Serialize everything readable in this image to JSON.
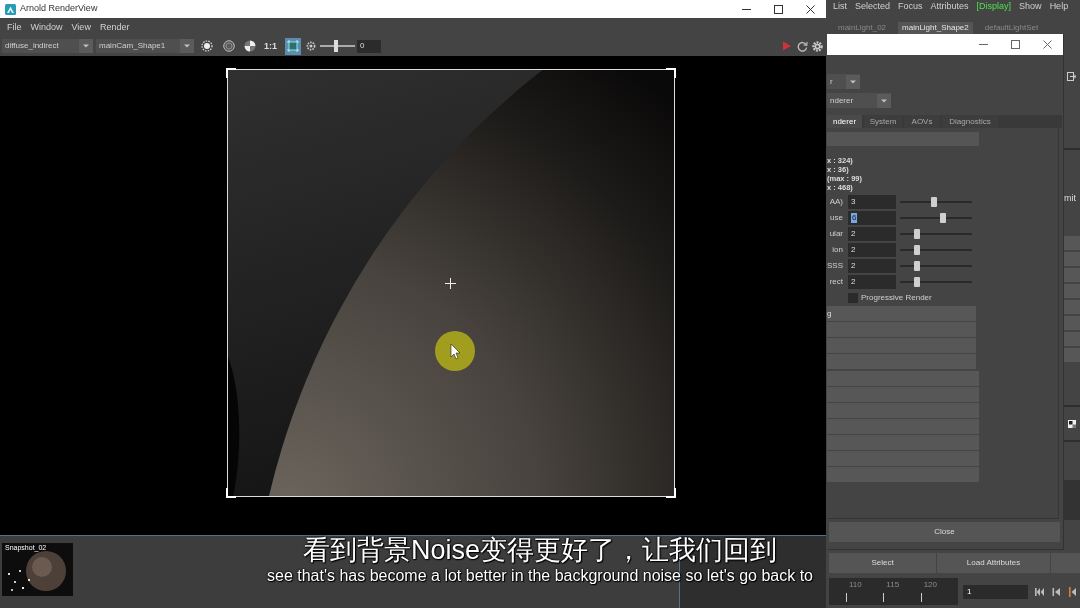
{
  "render_view": {
    "title": "Arnold RenderView",
    "menu": [
      "File",
      "Window",
      "View",
      "Render"
    ],
    "toolbar": {
      "aov": "diffuse_indirect",
      "camera": "mainCam_Shape1",
      "zoom": "1:1",
      "crop_region": true,
      "exposure": {
        "level": 0.45,
        "value": "0"
      }
    },
    "snapshots": [
      {
        "label": "Snapshot_02"
      }
    ]
  },
  "attribute_editor": {
    "menu": [
      {
        "label": "List",
        "active": false
      },
      {
        "label": "Selected",
        "active": false
      },
      {
        "label": "Focus",
        "active": false
      },
      {
        "label": "Attributes",
        "active": false
      },
      {
        "label": "[Display]",
        "active": true
      },
      {
        "label": "Show",
        "active": false
      },
      {
        "label": "Help",
        "active": false
      }
    ],
    "tabs": [
      {
        "label": "mainLight_02",
        "selected": false
      },
      {
        "label": "mainLight_Shape2",
        "selected": true
      },
      {
        "label": "defaultLightSet",
        "selected": false
      }
    ],
    "side_label": "mit",
    "buttons": [
      "Select",
      "Load Attributes"
    ],
    "timeline": {
      "ticks": [
        "110",
        "115",
        "120"
      ],
      "frame": "1"
    }
  },
  "render_settings": {
    "dropdowns": [
      "r",
      "nderer"
    ],
    "tabs": [
      {
        "label": "nderer",
        "selected": true
      },
      {
        "label": "System",
        "selected": false
      },
      {
        "label": "AOVs",
        "selected": false
      },
      {
        "label": "Diagnostics",
        "selected": false
      }
    ],
    "info": [
      "x : 324)",
      "x : 36)",
      "(max : 99)",
      "x : 468)"
    ],
    "samples": [
      {
        "label": "AA)",
        "value": "3",
        "level": 0.47,
        "text_selected": false
      },
      {
        "label": "use",
        "value": "6",
        "level": 0.6,
        "text_selected": true
      },
      {
        "label": "ular",
        "value": "2",
        "level": 0.24,
        "text_selected": false
      },
      {
        "label": "ion",
        "value": "2",
        "level": 0.24,
        "text_selected": false
      },
      {
        "label": "SSS",
        "value": "2",
        "level": 0.24,
        "text_selected": false
      },
      {
        "label": "rect",
        "value": "2",
        "level": 0.24,
        "text_selected": false
      }
    ],
    "progressive_render": {
      "label": "Progressive Render",
      "checked": false
    },
    "sections": [
      "g"
    ],
    "close": "Close"
  },
  "subtitles": {
    "chinese": "看到背景Noise变得更好了，让我们回到",
    "english": "see that's has become a lot better in the background noise so let's go back to"
  }
}
